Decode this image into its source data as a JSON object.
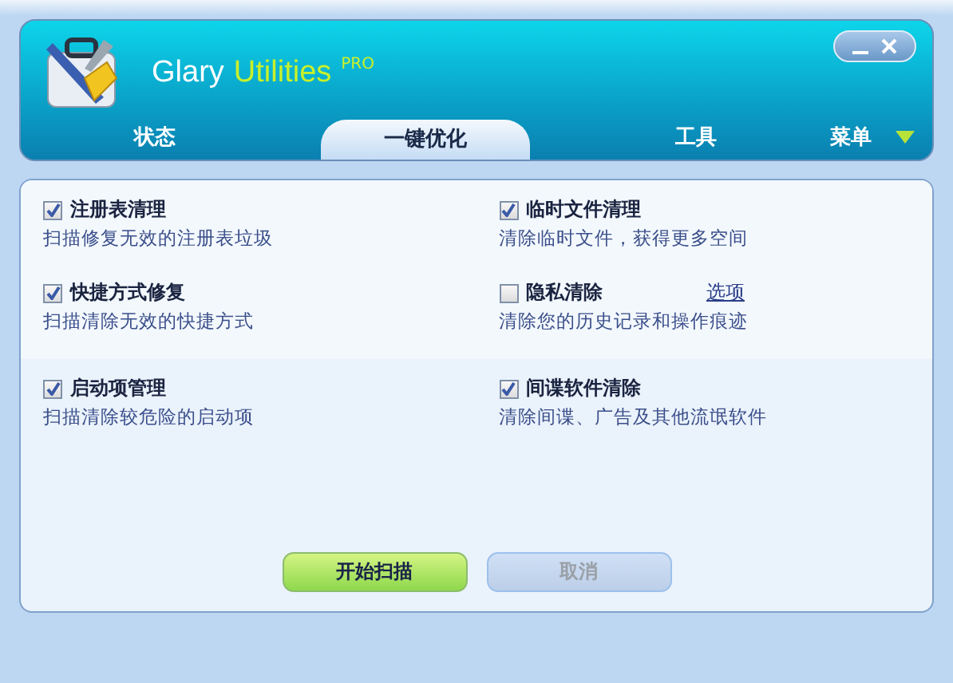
{
  "header": {
    "app_name": "Glary",
    "app_name_highlight": "Utilities",
    "edition": "PRO"
  },
  "tabs": [
    {
      "label": "状态",
      "selected": false
    },
    {
      "label": "一键优化",
      "selected": true
    },
    {
      "label": "工具",
      "selected": false
    }
  ],
  "menu": {
    "label": "菜单"
  },
  "sections": [
    {
      "items": [
        {
          "title": "注册表清理",
          "description": "扫描修复无效的注册表垃圾",
          "checked": true
        },
        {
          "title": "临时文件清理",
          "description": "清除临时文件，获得更多空间",
          "checked": true
        },
        {
          "title": "快捷方式修复",
          "description": "扫描清除无效的快捷方式",
          "checked": true
        },
        {
          "title": "隐私清除",
          "description": "清除您的历史记录和操作痕迹",
          "checked": false,
          "option_link": "选项"
        }
      ]
    },
    {
      "items": [
        {
          "title": "启动项管理",
          "description": "扫描清除较危险的启动项",
          "checked": true
        },
        {
          "title": "间谍软件清除",
          "description": "清除间谍、广告及其他流氓软件",
          "checked": true
        }
      ]
    }
  ],
  "buttons": [
    {
      "label": "开始扫描",
      "kind": "primary",
      "disabled": false
    },
    {
      "label": "取消",
      "kind": "secondary",
      "disabled": true
    }
  ]
}
